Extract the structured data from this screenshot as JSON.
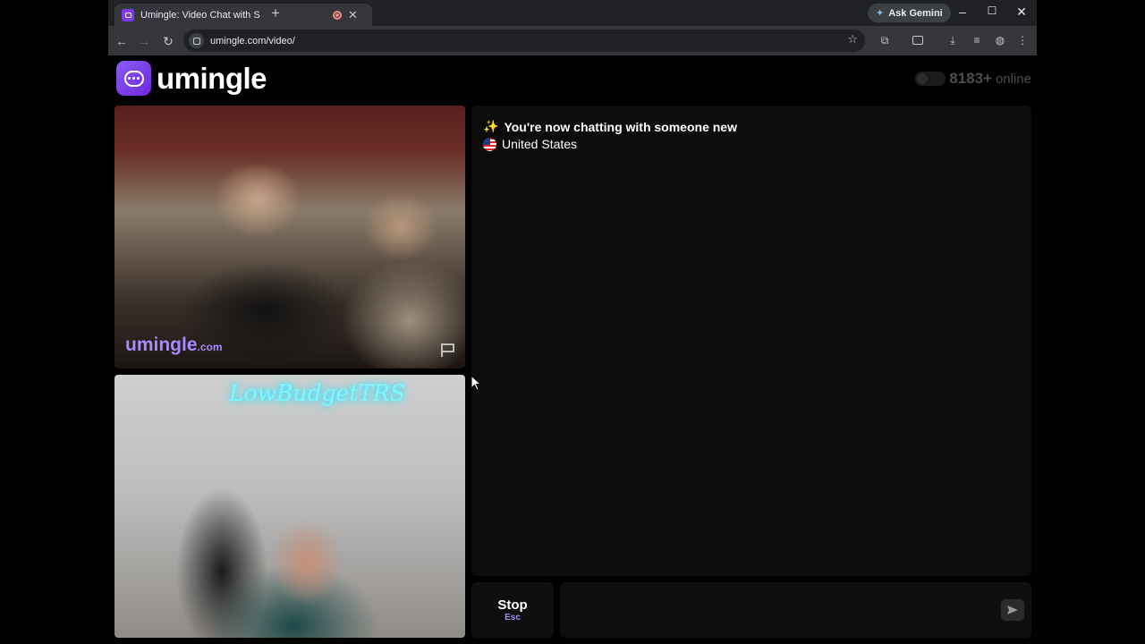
{
  "browser": {
    "tab_title": "Umingle: Video Chat with S",
    "new_tab_symbol": "+",
    "ask_gemini_label": "Ask Gemini",
    "url": "umingle.com/video/"
  },
  "site": {
    "logo_text": "umingle",
    "online_count": "8183+",
    "online_label": "online"
  },
  "video": {
    "remote_watermark": "umingle",
    "remote_watermark_suffix": ".com",
    "local_neon_sign": "LowBudgetTRS"
  },
  "chat": {
    "status_message": "You're now chatting with someone new",
    "country": "United States"
  },
  "controls": {
    "stop_label": "Stop",
    "stop_shortcut": "Esc",
    "message_placeholder": ""
  },
  "colors": {
    "brand_purple": "#7c3aed",
    "watermark_purple": "#a78bfa",
    "chat_bg": "#0c0c0c"
  }
}
